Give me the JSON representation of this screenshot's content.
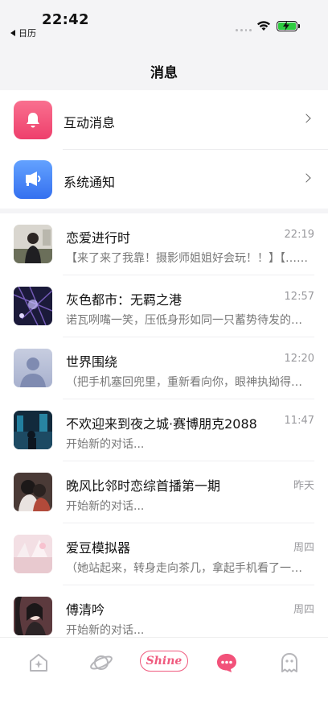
{
  "status_bar": {
    "time": "22:42",
    "back_app": "日历"
  },
  "header": {
    "title": "消息"
  },
  "system_items": [
    {
      "label": "互动消息",
      "icon": "bell-icon",
      "color": "#F2527A"
    },
    {
      "label": "系统通知",
      "icon": "megaphone-icon",
      "color": "#4A86F7"
    }
  ],
  "conversations": [
    {
      "name": "恋爱进行时",
      "time": "22:19",
      "preview": "【来了来了我靠！摄影师姐姐好会玩！！】【……"
    },
    {
      "name": "灰色都市：无羁之港",
      "time": "12:57",
      "preview": "诺瓦咧嘴一笑，压低身形如同一只蓄势待发的……"
    },
    {
      "name": "世界围绕",
      "time": "12:20",
      "preview": "（把手机塞回兜里，重新看向你，眼神执拗得……"
    },
    {
      "name": "不欢迎来到夜之城·赛博朋克2088",
      "time": "11:47",
      "preview": "开始新的对话..."
    },
    {
      "name": "晚风比邻时恋综首播第一期",
      "time": "昨天",
      "preview": "开始新的对话..."
    },
    {
      "name": "爱豆模拟器",
      "time": "周四",
      "preview": "（她站起来，转身走向茶几，拿起手机看了一……"
    },
    {
      "name": "傅清吟",
      "time": "周四",
      "preview": "开始新的对话..."
    }
  ],
  "tabbar": {
    "shine_label": "Shine",
    "active_color": "#F2527A",
    "tabs": [
      "home-icon",
      "planet-icon",
      "shine-tab",
      "messages-icon",
      "ghost-icon"
    ]
  }
}
